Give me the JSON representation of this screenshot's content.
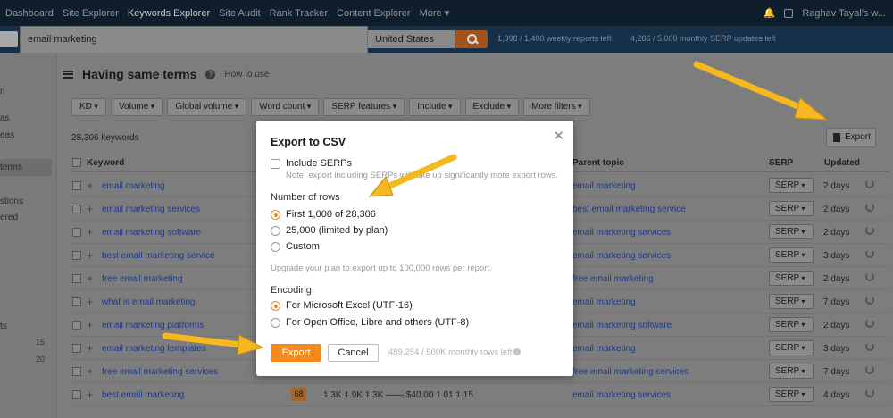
{
  "nav": {
    "items": [
      "Dashboard",
      "Site Explorer",
      "Keywords Explorer",
      "Site Audit",
      "Rank Tracker",
      "Content Explorer",
      "More ▾"
    ],
    "user": "Raghav Tayal's w..."
  },
  "search": {
    "query": "email marketing",
    "country": "United States",
    "quota_reports": "1,398 / 1,400 weekly reports left",
    "quota_serp": "4,286 / 5,000 monthly SERP updates left"
  },
  "sidebar": {
    "items": [
      "n",
      "as",
      "eas",
      "terms",
      "stions",
      "ered",
      "ts"
    ],
    "numbers": [
      "15",
      "20"
    ]
  },
  "page": {
    "title": "Having same terms",
    "howto": "How to use",
    "keyword_count": "28,306 keywords",
    "export_label": "Export"
  },
  "filters": [
    "KD",
    "Volume",
    "Global volume",
    "Word count",
    "SERP features",
    "Include",
    "Exclude",
    "More filters"
  ],
  "table": {
    "headers": {
      "keyword": "Keyword",
      "topic": "Parent topic",
      "serp": "SERP",
      "updated": "Updated"
    },
    "rows": [
      {
        "keyword": "email marketing",
        "topic": "email marketing",
        "serp": "SERP",
        "updated": "2 days"
      },
      {
        "keyword": "email marketing services",
        "topic": "best email marketing service",
        "serp": "SERP",
        "updated": "2 days"
      },
      {
        "keyword": "email marketing software",
        "topic": "email marketing services",
        "serp": "SERP",
        "updated": "2 days"
      },
      {
        "keyword": "best email marketing service",
        "topic": "email marketing services",
        "serp": "SERP",
        "updated": "3 days"
      },
      {
        "keyword": "free email marketing",
        "topic": "free email marketing",
        "serp": "SERP",
        "updated": "2 days"
      },
      {
        "keyword": "what is email marketing",
        "topic": "email marketing",
        "serp": "SERP",
        "updated": "7 days"
      },
      {
        "keyword": "email marketing platforms",
        "topic": "email marketing software",
        "serp": "SERP",
        "updated": "2 days"
      },
      {
        "keyword": "email marketing templates",
        "topic": "email marketing",
        "serp": "SERP",
        "updated": "3 days"
      },
      {
        "keyword": "free email marketing services",
        "topic": "free email marketing services",
        "serp": "SERP",
        "updated": "7 days"
      },
      {
        "keyword": "best email marketing",
        "topic": "email marketing services",
        "serp": "SERP",
        "updated": "4 days",
        "kd": "68",
        "cells": "1.3K        1.9K        1.3K        ——        $40.00    1.01    1.15"
      }
    ]
  },
  "modal": {
    "title": "Export to CSV",
    "include_serps": "Include SERPs",
    "include_note": "Note, export including SERPs will take up significantly more export rows.",
    "rows_heading": "Number of rows",
    "rows_options": [
      "First 1,000 of 28,306",
      "25,000 (limited by plan)",
      "Custom"
    ],
    "upgrade_note": "Upgrade your plan to export up to 100,000 rows per report.",
    "encoding_heading": "Encoding",
    "encoding_options": [
      "For Microsoft Excel (UTF-16)",
      "For Open Office, Libre and others (UTF-8)"
    ],
    "export_btn": "Export",
    "cancel_btn": "Cancel",
    "rows_left": "489,254 / 500K monthly rows left"
  },
  "colors": {
    "accent": "#f48a1e",
    "arrow": "#f5b820",
    "link": "#1e3a88"
  }
}
